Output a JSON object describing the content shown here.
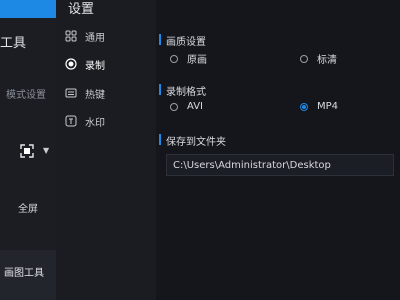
{
  "app": {
    "tools_title": "工具",
    "mode_settings": "模式设置",
    "fullscreen_label": "全屏",
    "draw_tools_label": "画图工具"
  },
  "settings": {
    "title": "设置",
    "nav": [
      {
        "label": "通用",
        "icon": "grid-icon",
        "active": false
      },
      {
        "label": "录制",
        "icon": "record-icon",
        "active": true
      },
      {
        "label": "热键",
        "icon": "keyboard-icon",
        "active": false
      },
      {
        "label": "水印",
        "icon": "watermark-icon",
        "active": false
      }
    ],
    "quality": {
      "title": "画质设置",
      "options": [
        {
          "label": "原画",
          "checked": false
        },
        {
          "label": "标清",
          "checked": false
        }
      ]
    },
    "format": {
      "title": "录制格式",
      "options": [
        {
          "label": "AVI",
          "checked": false
        },
        {
          "label": "MP4",
          "checked": true
        }
      ]
    },
    "folder": {
      "title": "保存到文件夹",
      "value": "C:\\Users\\Administrator\\Desktop"
    }
  },
  "colors": {
    "accent": "#1e88e5",
    "background": "#14161b",
    "sidebar": "#1a1c21"
  }
}
